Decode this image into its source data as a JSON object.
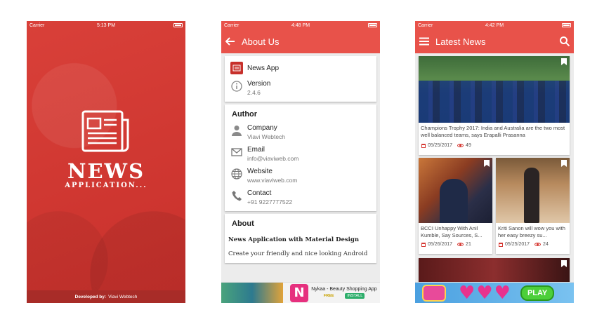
{
  "splash": {
    "status": {
      "carrier": "Carrier",
      "time": "5:13 PM"
    },
    "brand_title": "NEWS",
    "brand_subtitle": "APPLICATION...",
    "footer_label": "Developed by:",
    "footer_value": "Viavi Webtech"
  },
  "about": {
    "status": {
      "carrier": "Carrier",
      "time": "4:48 PM"
    },
    "title": "About Us",
    "app_name": "News App",
    "version_label": "Version",
    "version_value": "2.4.6",
    "author_heading": "Author",
    "company_label": "Company",
    "company_value": "Viavi Webtech",
    "email_label": "Email",
    "email_value": "info@viaviweb.com",
    "website_label": "Website",
    "website_value": "www.viaviweb.com",
    "contact_label": "Contact",
    "contact_value": "+91 9227777522",
    "about_heading": "About",
    "about_title": "News Application with Material Design",
    "about_body": "Create your friendly and nice looking Android",
    "ad_title": "Nykaa - Beauty Shopping App",
    "ad_free": "FREE",
    "ad_install": "INSTALL"
  },
  "news": {
    "status": {
      "carrier": "Carrier",
      "time": "4:42 PM"
    },
    "title": "Latest News",
    "items": [
      {
        "title": "Champions Trophy 2017: India and Australia are the two most well balanced teams, says Erapalli Prasanna",
        "date": "05/25/2017",
        "views": "49"
      },
      {
        "title": "BCCI Unhappy With Anil Kumble, Say Sources, S...",
        "date": "05/26/2017",
        "views": "21"
      },
      {
        "title": "Kriti Sanon will wow you with her easy breezy su...",
        "date": "05/25/2017",
        "views": "24"
      }
    ],
    "ad_title": "PLAY"
  },
  "colors": {
    "primary": "#e8524a",
    "splash": "#d63a34"
  }
}
